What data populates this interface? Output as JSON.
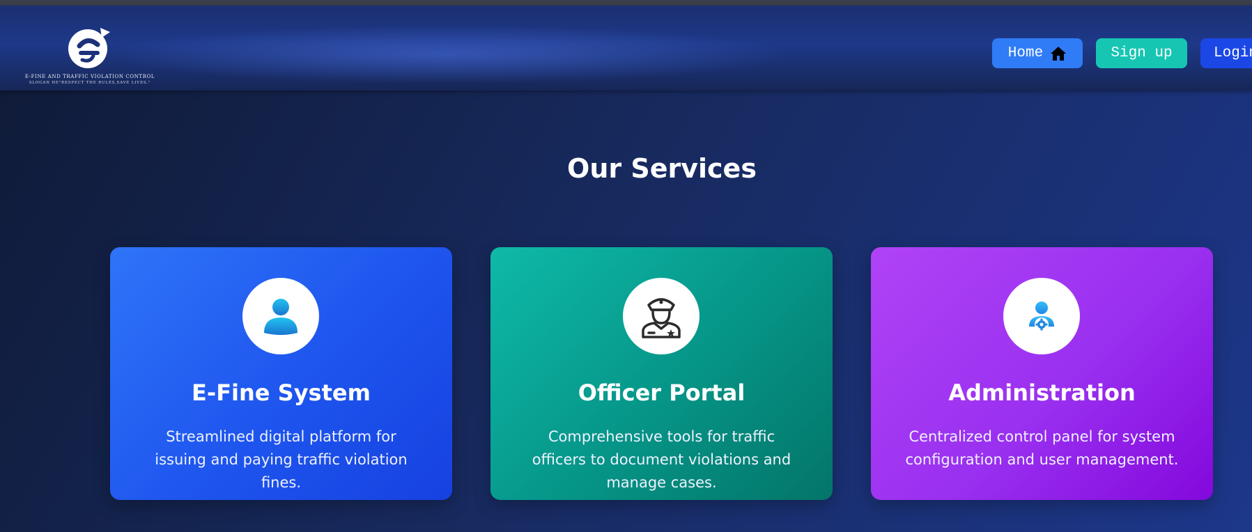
{
  "header": {
    "logo": {
      "line1": "E-FINE AND TRAFFIC VIOLATION CONTROL",
      "line2": "SLOGAN HE\"RESPECT THE RULES,SAVE LIVES.\""
    },
    "nav": {
      "home_label": "Home",
      "signup_label": "Sign up",
      "login_label": "Login"
    }
  },
  "main": {
    "title": "Our Services",
    "services": [
      {
        "icon": "user-icon",
        "title": "E-Fine System",
        "description": "Streamlined digital platform for issuing and paying traffic violation fines.",
        "color": "#2563eb"
      },
      {
        "icon": "police-officer-icon",
        "title": "Officer Portal",
        "description": "Comprehensive tools for traffic officers to document violations and manage cases.",
        "color": "#0d9488"
      },
      {
        "icon": "admin-user-gear-icon",
        "title": "Administration",
        "description": "Centralized control panel for system configuration and user management.",
        "color": "#9333ea"
      }
    ]
  }
}
